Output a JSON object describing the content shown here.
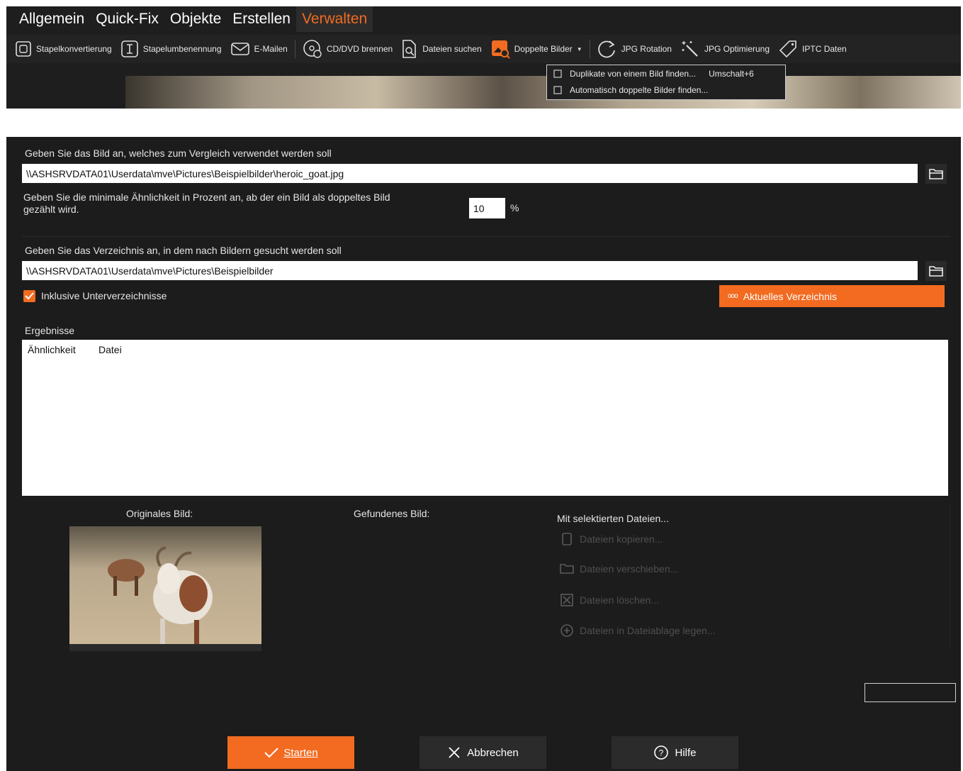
{
  "menu": {
    "tabs": [
      "Allgemein",
      "Quick-Fix",
      "Objekte",
      "Erstellen",
      "Verwalten"
    ],
    "active": "Verwalten"
  },
  "toolbar": {
    "batch_convert": "Stapelkonvertierung",
    "batch_rename": "Stapelumbenennung",
    "email": "E-Mailen",
    "burn": "CD/DVD brennen",
    "find_files": "Dateien suchen",
    "duplicates": "Doppelte Bilder",
    "jpg_rotation": "JPG Rotation",
    "jpg_optimize": "JPG Optimierung",
    "iptc": "IPTC Daten"
  },
  "dropdown": {
    "item1": "Duplikate von einem Bild finden...",
    "item1_shortcut": "Umschalt+6",
    "item2": "Automatisch doppelte Bilder finden..."
  },
  "form": {
    "compare_label": "Geben Sie das Bild an, welches zum Vergleich verwendet werden soll",
    "compare_path": "\\\\ASHSRVDATA01\\Userdata\\mve\\Pictures\\Beispielbilder\\heroic_goat.jpg",
    "similarity_label_1": "Geben Sie die minimale Ähnlichkeit in Prozent an, ab der ein Bild als doppeltes Bild",
    "similarity_label_2": "gezählt wird.",
    "similarity_value": "10",
    "similarity_unit": "%",
    "dir_label": "Geben Sie das Verzeichnis an, in dem nach Bildern gesucht werden soll",
    "dir_path": "\\\\ASHSRVDATA01\\Userdata\\mve\\Pictures\\Beispielbilder",
    "include_subdirs": "Inklusive Unterverzeichnisse",
    "include_subdirs_checked": true,
    "current_dir_button": "Aktuelles Verzeichnis"
  },
  "results": {
    "label": "Ergebnisse",
    "columns": [
      "Ähnlichkeit",
      "Datei"
    ]
  },
  "preview": {
    "original_label": "Originales Bild:",
    "found_label": "Gefundenes Bild:"
  },
  "actions": {
    "title": "Mit selektierten Dateien...",
    "copy": "Dateien kopieren...",
    "move": "Dateien verschieben...",
    "delete": "Dateien löschen...",
    "clipboard": "Dateien in Dateiablage legen..."
  },
  "buttons": {
    "start": "Starten",
    "cancel": "Abbrechen",
    "help": "Hilfe"
  },
  "colors": {
    "accent": "#f26b21",
    "background": "#1c1c1c",
    "toolbar": "#232323"
  }
}
